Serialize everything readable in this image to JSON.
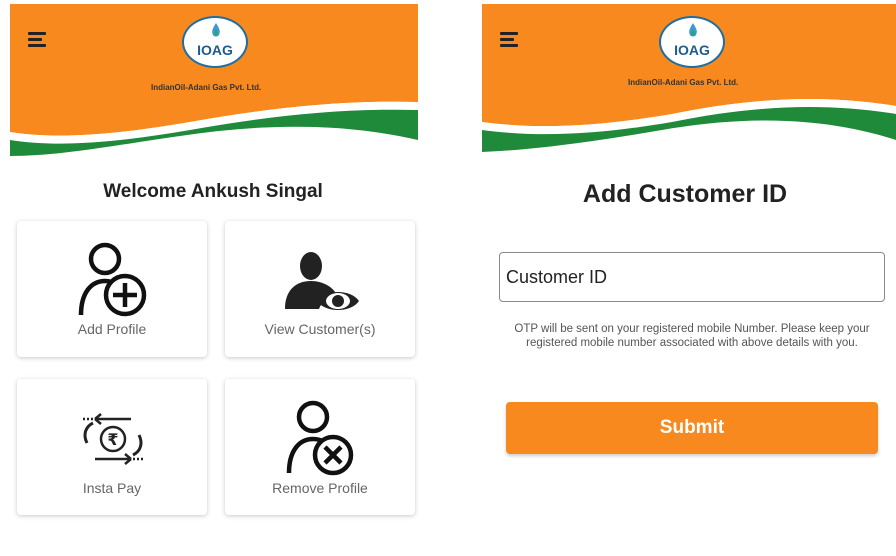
{
  "brand": {
    "logo_text": "IOAG",
    "company_name": "IndianOil-Adani Gas Pvt. Ltd.",
    "colors": {
      "orange": "#f7891f",
      "green": "#1e8a3a",
      "navy": "#1f5a8c"
    }
  },
  "home_screen": {
    "menu_icon": "hamburger-icon",
    "welcome_text": "Welcome Ankush  Singal",
    "tiles": [
      {
        "label": "Add Profile",
        "icon": "add-profile-icon"
      },
      {
        "label": "View Customer(s)",
        "icon": "view-customer-icon"
      },
      {
        "label": "Insta Pay",
        "icon": "rupee-exchange-icon"
      },
      {
        "label": "Remove Profile",
        "icon": "remove-profile-icon"
      }
    ]
  },
  "customer_screen": {
    "menu_icon": "hamburger-icon",
    "title": "Add Customer ID",
    "input": {
      "placeholder": "Customer ID",
      "value": ""
    },
    "otp_note": "OTP will be sent on your registered mobile Number. Please keep your registered mobile number associated with above details with you.",
    "submit_label": "Submit"
  }
}
